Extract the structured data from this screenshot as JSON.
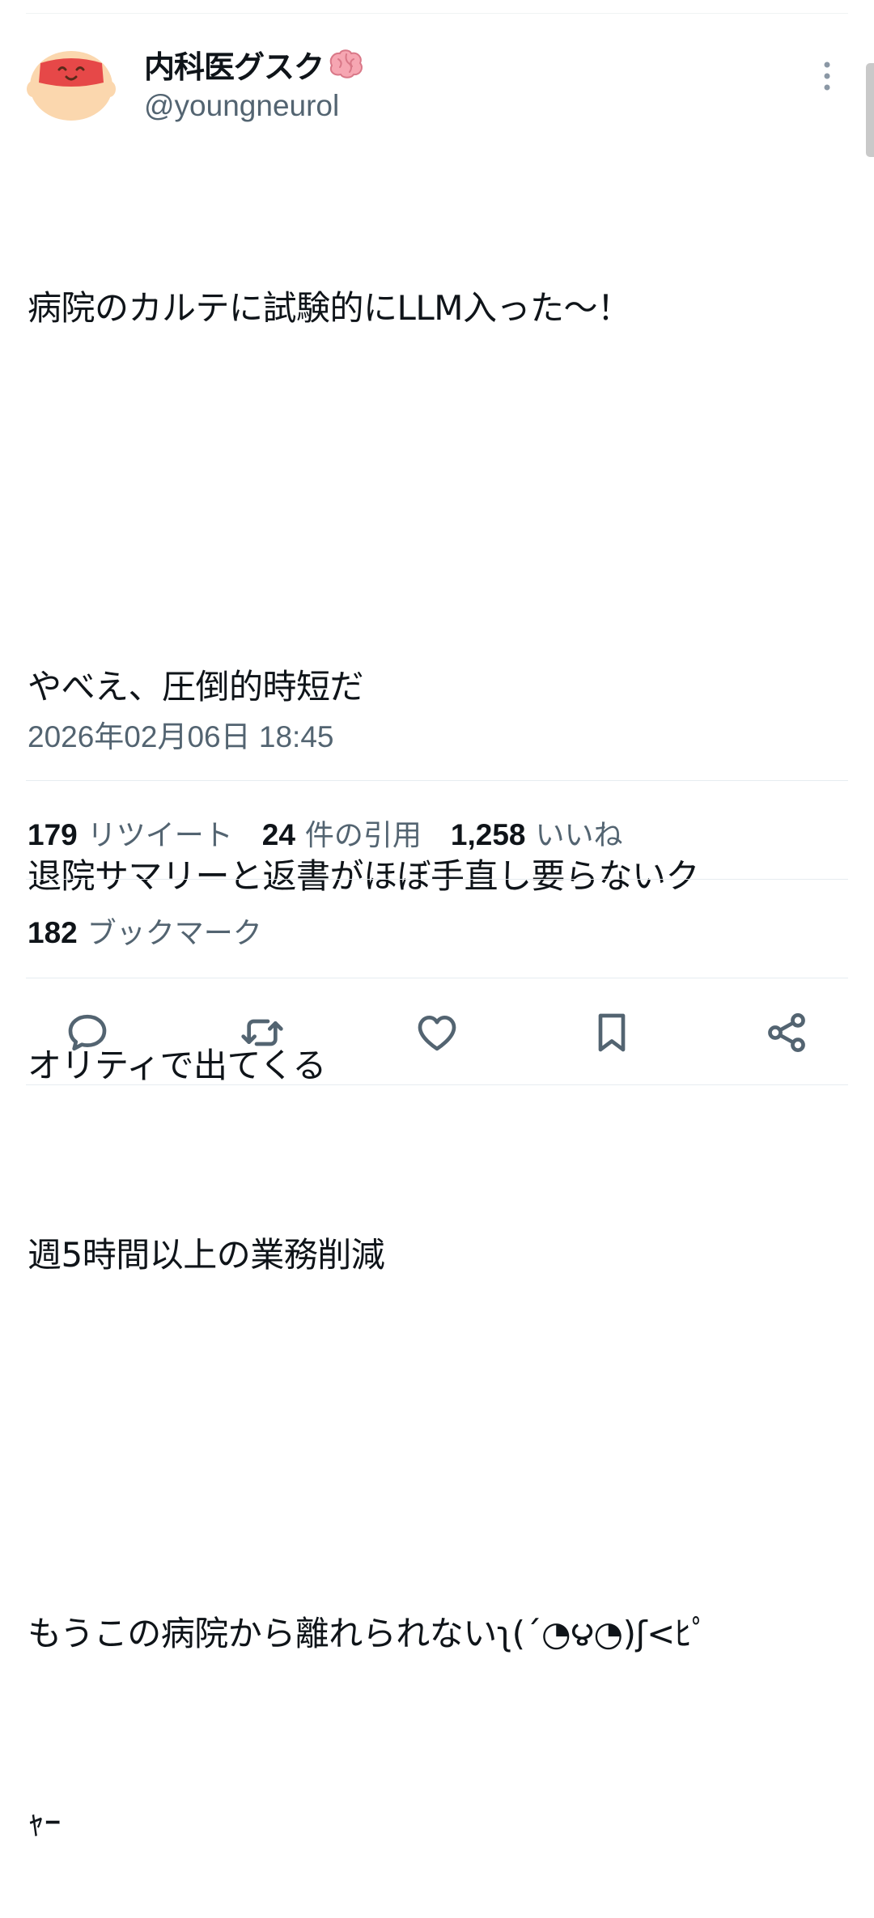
{
  "author": {
    "display_name": "内科医グスク",
    "handle": "@youngneurol",
    "name_emoji_icon": "brain-icon"
  },
  "tweet": {
    "lines": [
      "病院のカルテに試験的にLLM入った〜！",
      "",
      "やべえ、圧倒的時短だ",
      "退院サマリーと返書がほぼ手直し要らないク",
      "オリティで出てくる",
      "週5時間以上の業務削減",
      "",
      "もうこの病院から離れられないʅ(´◔౪◔)ʃ<ﾋﾟ",
      "ｬｰ"
    ],
    "timestamp": "2026年02月06日 18:45"
  },
  "stats": {
    "retweets_count": "179",
    "retweets_label": "リツイート",
    "quotes_count": "24",
    "quotes_label": "件の引用",
    "likes_count": "1,258",
    "likes_label": "いいね",
    "bookmarks_count": "182",
    "bookmarks_label": "ブックマーク"
  },
  "actions": [
    "reply-icon",
    "retweet-icon",
    "like-icon",
    "bookmark-icon",
    "share-icon"
  ],
  "colors": {
    "text_primary": "#0f1419",
    "text_secondary": "#536471",
    "divider": "#e6ecf0",
    "avatar_skin": "#fbd7ae",
    "avatar_band": "#e64848"
  }
}
